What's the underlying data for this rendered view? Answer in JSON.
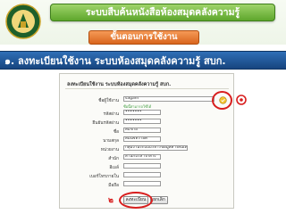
{
  "header": {
    "title": "ระบบสืบค้นหนังสือห้องสมุดคลังความรู้",
    "subtitle": "ขั้นตอนการใช้งาน"
  },
  "step": {
    "label": "๑. ลงทะเบียนใช้งาน ระบบห้องสมุดคลังความรู้ สบก."
  },
  "form": {
    "title": "ลงทะเบียนใช้งาน ระบบห้องสมุดคลังความรู้ สบก.",
    "hint": "ชื่อนี้สามารถใช้ได้",
    "fields": [
      {
        "label": "ชื่อผู้ใช้งาน",
        "value": "sagam"
      },
      {
        "label": "รหัสผ่าน",
        "value": "•••••••"
      },
      {
        "label": "ยืนยันรหัสผ่าน",
        "value": "•••••••"
      },
      {
        "label": "ชื่อ",
        "value": "สมชาย"
      },
      {
        "label": "นามสกุล",
        "value": "สมันจ์ทรายต์"
      },
      {
        "label": "หน่วยงาน",
        "value": "กลุ่มงานระบบบริหารข้อมูลสารสนเทศ"
      },
      {
        "label": "สำนัก",
        "value": "สำนักบริหารกลาง"
      },
      {
        "label": "อีเมล์",
        "value": ""
      },
      {
        "label": "เบอร์โทรภายใน",
        "value": ""
      },
      {
        "label": "มือถือ",
        "value": ""
      }
    ],
    "submit_label": "ลงทะเบียน",
    "cancel_label": "ยกเลิก"
  },
  "markers": {
    "step1": "๑",
    "step2": "๒"
  },
  "colors": {
    "title_green": "#5ea62c",
    "subtitle_orange": "#d9651d",
    "step_blue": "#17457f",
    "annotation_red": "#d81e1e"
  }
}
